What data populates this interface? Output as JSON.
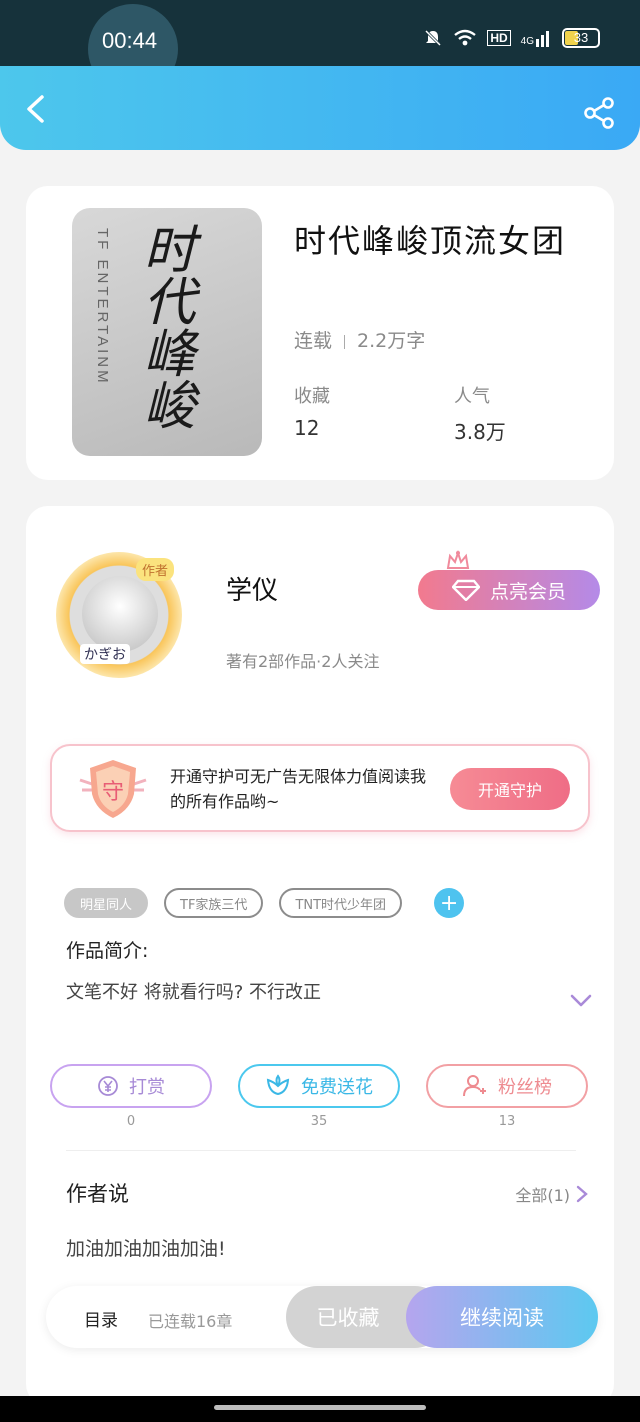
{
  "status_bar": {
    "time": "00:44",
    "network": "4G",
    "hd": "HD",
    "battery": "33"
  },
  "book": {
    "cover_text_en": "TF ENTERTAINM",
    "cover_text_cn": "时代峰峻",
    "title": "时代峰峻顶流女团",
    "status": "连载",
    "word_count": "2.2万字",
    "favorites_label": "收藏",
    "favorites_value": "12",
    "popularity_label": "人气",
    "popularity_value": "3.8万"
  },
  "author": {
    "badge": "作者",
    "avatar_tag": "かぎお",
    "name": "学仪",
    "meta": "著有2部作品·2人关注",
    "vip_button": "点亮会员"
  },
  "guard": {
    "shield_char": "守",
    "text": "开通守护可无广告无限体力值阅读我的所有作品哟~",
    "button": "开通守护"
  },
  "tags": [
    "明星同人",
    "TF家族三代",
    "TNT时代少年团"
  ],
  "intro": {
    "title": "作品简介:",
    "text": "文笔不好   将就看行吗?     不行改正"
  },
  "actions": {
    "reward_label": "打赏",
    "reward_count": "0",
    "flower_label": "免费送花",
    "flower_count": "35",
    "fans_label": "粉丝榜",
    "fans_count": "13"
  },
  "author_says": {
    "title": "作者说",
    "all_label": "全部(1)",
    "text": "加油加油加油加油!"
  },
  "bottom": {
    "toc": "目录",
    "chapters": "已连载16章",
    "collected": "已收藏",
    "continue": "继续阅读"
  },
  "colors": {
    "header_start": "#4dc7ec",
    "header_end": "#3aa9f5",
    "accent_blue": "#4ec3ef",
    "accent_pink": "#ef6d86"
  }
}
